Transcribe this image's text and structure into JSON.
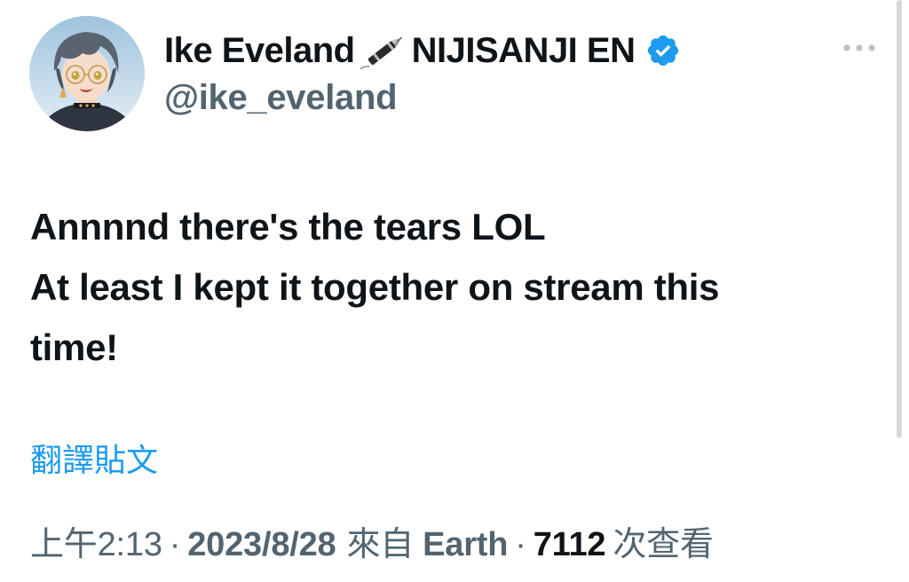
{
  "tweet": {
    "author": {
      "display_name": "Ike Eveland",
      "affiliation": "NIJISANJI EN",
      "handle": "@ike_eveland",
      "verified": true
    },
    "text_lines": [
      "Annnnd there's the tears LOL",
      "At least I kept it together on stream this",
      "time!"
    ],
    "translate_label": "翻譯貼文",
    "meta": {
      "time": "上午2:13",
      "separator": "·",
      "date": "2023/8/28",
      "source_prefix": "來自",
      "source": "Earth",
      "views_count": "7112",
      "views_label": "次查看"
    }
  },
  "icons": {
    "pen": "fountain-pen-icon",
    "verified": "verified-badge-icon",
    "more": "more-options-icon"
  },
  "colors": {
    "text_primary": "#0f1419",
    "text_secondary": "#536471",
    "link": "#1d9bf0",
    "verified": "#1d9bf0"
  }
}
